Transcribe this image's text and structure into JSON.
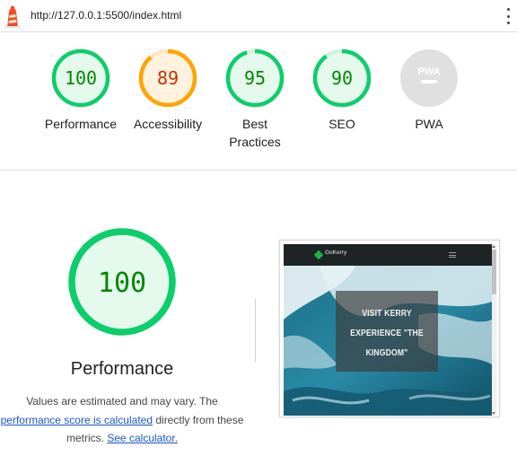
{
  "address_bar": {
    "url": "http://127.0.0.1:5500/index.html"
  },
  "icons": {
    "logo": "lighthouse-icon",
    "menu": "more-vertical-icon",
    "pwa": "pwa-badge-icon"
  },
  "colors": {
    "pass": "#0cce6b",
    "pass_text": "#008800",
    "average": "#ffa400",
    "average_text": "#c33300",
    "na": "#e0e0e0"
  },
  "categories": [
    {
      "label": "Performance",
      "score": "100",
      "status": "pass"
    },
    {
      "label": "Accessibility",
      "score": "89",
      "status": "average"
    },
    {
      "label": "Best\nPractices",
      "score": "95",
      "status": "pass"
    },
    {
      "label": "SEO",
      "score": "90",
      "status": "pass"
    },
    {
      "label": "PWA",
      "score": "",
      "status": "na",
      "badge_text": "PWA"
    }
  ],
  "performance": {
    "score": "100",
    "title": "Performance",
    "desc_prefix": "Values are estimated and may vary. The ",
    "link_score": "performance score is calculated",
    "desc_middle": " directly from these metrics. ",
    "link_calc": "See calculator."
  },
  "screenshot": {
    "brand": "GoKerry",
    "hero_lines": [
      "VISIT KERRY",
      "EXPERIENCE \"THE",
      "KINGDOM\""
    ]
  }
}
